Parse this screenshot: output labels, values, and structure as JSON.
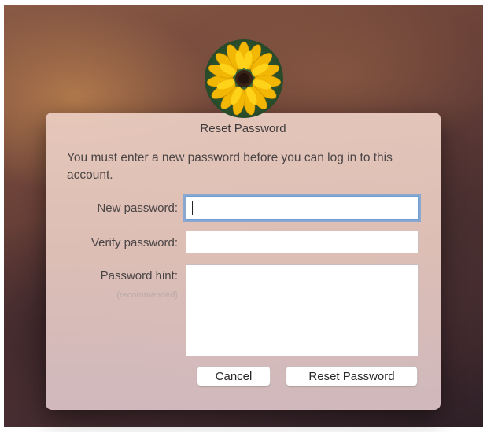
{
  "dialog": {
    "title": "Reset Password",
    "message": "You must enter a new password before you can log in to this account.",
    "new_password_label": "New password:",
    "new_password_value": "",
    "verify_password_label": "Verify password:",
    "verify_password_value": "",
    "hint_label": "Password hint:",
    "hint_sublabel": "(recommended)",
    "hint_value": "",
    "cancel_label": "Cancel",
    "reset_label": "Reset Password"
  },
  "user": {
    "avatar_icon": "sunflower-avatar-icon"
  },
  "colors": {
    "focus_ring": "#6c9fd8",
    "dialog_bg": "#e6c8bc"
  }
}
